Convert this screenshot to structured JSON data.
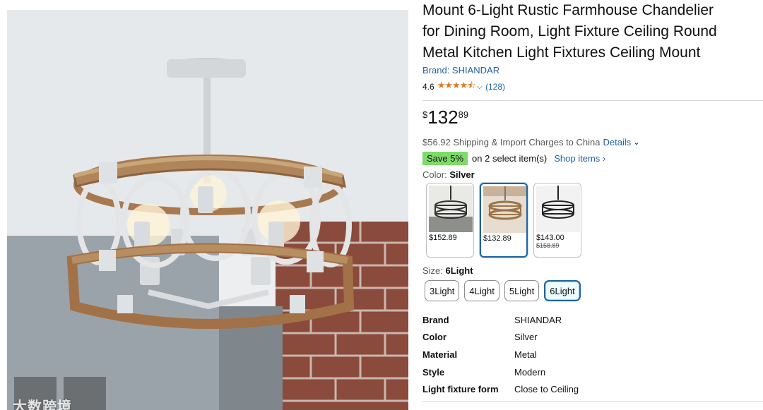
{
  "product": {
    "title_lines": [
      "Mount 6-Light Rustic Farmhouse Chandelier",
      "for Dining Room, Light Fixture Ceiling Round",
      "Metal Kitchen Light Fixtures Ceiling Mount"
    ],
    "brand_link": "Brand: SHIANDAR",
    "rating": "4.6",
    "stars": "★★★★",
    "half_star": "⯪",
    "chevron": "⌵",
    "review_count": "(128)"
  },
  "price": {
    "symbol": "$",
    "whole": "132",
    "fraction": "89"
  },
  "shipping": {
    "text": "$56.92 Shipping & Import Charges to China",
    "details": "Details",
    "caret": "⌄"
  },
  "coupon": {
    "badge": "Save 5%",
    "text": "on 2 select item(s)",
    "link": "Shop items ›"
  },
  "color": {
    "label": "Color:",
    "value": "Silver",
    "options": [
      {
        "price": "$152.89",
        "old_price": ""
      },
      {
        "price": "$132.89",
        "old_price": ""
      },
      {
        "price": "$143.00",
        "old_price": "$158.89"
      }
    ]
  },
  "size": {
    "label": "Size:",
    "value": "6Light",
    "options": [
      "3Light",
      "4Light",
      "5Light",
      "6Light"
    ],
    "selected": "6Light"
  },
  "specs": [
    {
      "key": "Brand",
      "value": "SHIANDAR"
    },
    {
      "key": "Color",
      "value": "Silver"
    },
    {
      "key": "Material",
      "value": "Metal"
    },
    {
      "key": "Style",
      "value": "Modern"
    },
    {
      "key": "Light fixture form",
      "value": "Close to Ceiling"
    }
  ],
  "colors": {
    "link": "#2162a1",
    "star": "#de7921",
    "badge": "#7fda69",
    "selected_border": "#2162a1"
  },
  "image": {
    "watermark": "大数跨境"
  }
}
